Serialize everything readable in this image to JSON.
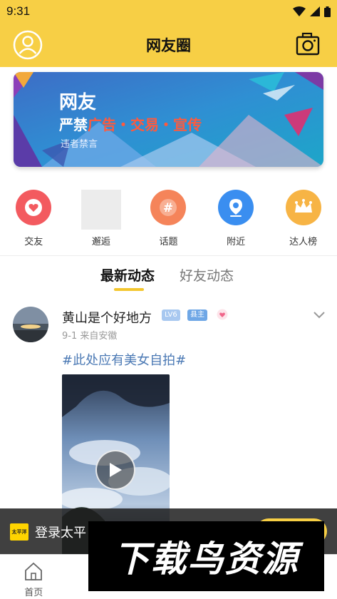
{
  "status_bar": {
    "time": "9:31"
  },
  "header": {
    "title": "网友圈"
  },
  "banner": {
    "title": "网友",
    "line_prefix": "严禁",
    "line_highlight": "广告・交易・宣传",
    "subtitle": "违者禁言"
  },
  "quick_nav": [
    {
      "label": "交友",
      "icon": "heart-chat-icon",
      "color": "#f35a5f"
    },
    {
      "label": "邂逅",
      "icon": "image-placeholder",
      "color": "#ececec"
    },
    {
      "label": "话题",
      "icon": "hashtag-icon",
      "color": "#f5845a"
    },
    {
      "label": "附近",
      "icon": "location-icon",
      "color": "#3a8ef0"
    },
    {
      "label": "达人榜",
      "icon": "crown-icon",
      "color": "#f7b445"
    }
  ],
  "feed_tabs": {
    "latest": "最新动态",
    "friends": "好友动态"
  },
  "post": {
    "username": "黄山是个好地方",
    "level_badge": "LV6",
    "role_badge": "县主",
    "meta": "9-1  来自安徽",
    "topic": "#此处应有美女自拍#"
  },
  "login_bar": {
    "logo_text": "太平洋",
    "text": "登录太平"
  },
  "bottom_nav": [
    {
      "label": "首页",
      "icon": "home-icon"
    },
    {
      "label": "",
      "icon": "tab-2-icon"
    },
    {
      "label": "",
      "icon": "tab-3-icon"
    },
    {
      "label": "",
      "icon": "tab-4-icon"
    },
    {
      "label": "",
      "icon": "tab-5-icon"
    }
  ],
  "watermark": {
    "text": "下载鸟资源"
  },
  "colors": {
    "accent": "#f7cf45",
    "topic": "#4b79b4",
    "active_tab": "#f3c62e"
  }
}
